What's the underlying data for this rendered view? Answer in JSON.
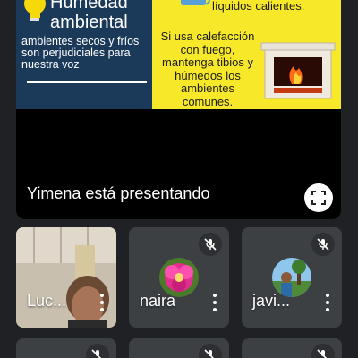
{
  "presentation": {
    "slide": {
      "title": "Humedad ambiental",
      "left_text": "ambientes secos y fríos son perjudiciales para nuestra voz",
      "right_top_text": "líquidos calientes.",
      "right_main_text": "Si usa calefacción con fuego, mantenga tibios y húmedos los ambientes comunes."
    },
    "presenting_label": "Yimena está presentando",
    "fullscreen_icon": "fullscreen-icon"
  },
  "participants": [
    {
      "name": "Luc...",
      "muted": false,
      "video": true
    },
    {
      "name": "naira",
      "muted": true,
      "video": false,
      "avatar": "flower-photo"
    },
    {
      "name": "javi...",
      "muted": true,
      "video": false,
      "avatar": "person-outdoors-photo"
    }
  ],
  "colors": {
    "background": "#202124",
    "tile": "#3c4043",
    "slide_left": "#1b3a5a",
    "slide_right": "#f7e92a"
  }
}
